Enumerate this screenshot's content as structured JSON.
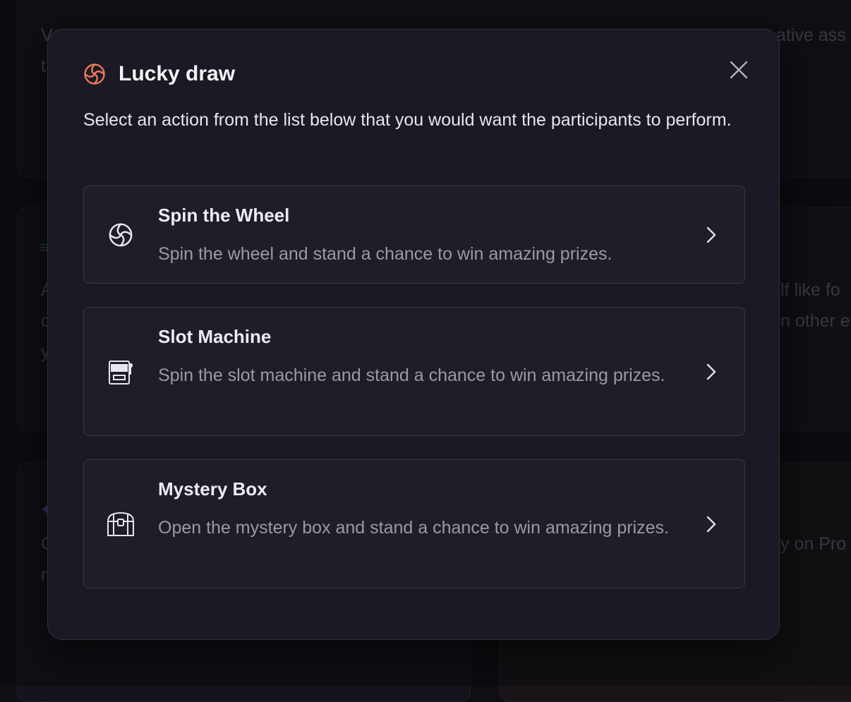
{
  "modal": {
    "title": "Lucky draw",
    "description": "Select an action from the list below that you would want the participants to perform.",
    "title_icon": "wheel-icon",
    "close_icon": "close-icon",
    "accent_color": "#f0795a",
    "options": [
      {
        "title": "Spin the Wheel",
        "description": "Spin the wheel and stand a chance to win amazing prizes.",
        "icon": "wheel-icon"
      },
      {
        "title": "Slot Machine",
        "description": "Spin the slot machine and stand a chance to win amazing prizes.",
        "icon": "slot-machine-icon"
      },
      {
        "title": "Mystery Box",
        "description": "Open the mystery box and stand a chance to win amazing prizes.",
        "icon": "treasure-chest-icon"
      }
    ]
  },
  "background": {
    "fragments": [
      "V",
      "t",
      "ative ass",
      "A",
      "c",
      "y",
      "lf like fo",
      "n other e",
      "C",
      "r",
      "y on Pro"
    ]
  }
}
